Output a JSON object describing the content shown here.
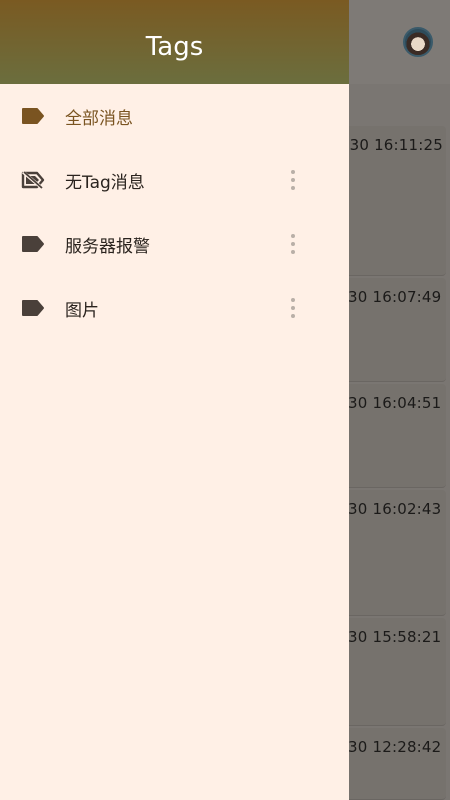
{
  "drawer": {
    "title": "Tags",
    "items": [
      {
        "label": "全部消息",
        "icon": "tag-icon",
        "active": true,
        "has_menu": false
      },
      {
        "label": "无Tag消息",
        "icon": "tag-off-icon",
        "active": false,
        "has_menu": true
      },
      {
        "label": "服务器报警",
        "icon": "tag-icon",
        "active": false,
        "has_menu": true
      },
      {
        "label": "图片",
        "icon": "tag-icon",
        "active": false,
        "has_menu": true
      }
    ]
  },
  "background": {
    "messages": [
      {
        "time": "-30 16:11:25"
      },
      {
        "time": "30 16:07:49"
      },
      {
        "time": "30 16:04:51"
      },
      {
        "time": "30 16:02:43"
      },
      {
        "time": "30 15:58:21"
      },
      {
        "time": "30 12:28:42"
      }
    ]
  },
  "colors": {
    "accent": "#7a5421",
    "drawer_bg": "#fff0e6",
    "header_top": "#7a5a22",
    "header_bottom": "#6b6e3e"
  }
}
